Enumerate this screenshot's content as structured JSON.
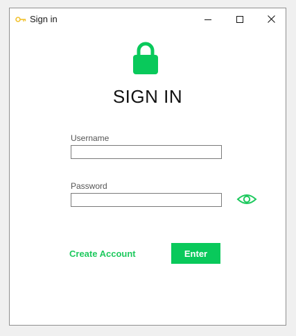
{
  "window": {
    "title": "Sign in",
    "title_icon": "key-icon",
    "controls": [
      "minimize-icon",
      "maximize-icon",
      "close-icon"
    ]
  },
  "main": {
    "lock_icon": "lock-icon",
    "heading": "SIGN IN",
    "username_label": "Username",
    "username_value": "",
    "password_label": "Password",
    "password_value": "",
    "show_password_icon": "eye-icon",
    "create_account_label": "Create Account",
    "enter_label": "Enter"
  },
  "colors": {
    "accent": "#09c95b",
    "link": "#1ec95e",
    "title_icon": "#f2c12e",
    "text": "#111111",
    "label": "#555555",
    "border": "#7a7a7a"
  }
}
